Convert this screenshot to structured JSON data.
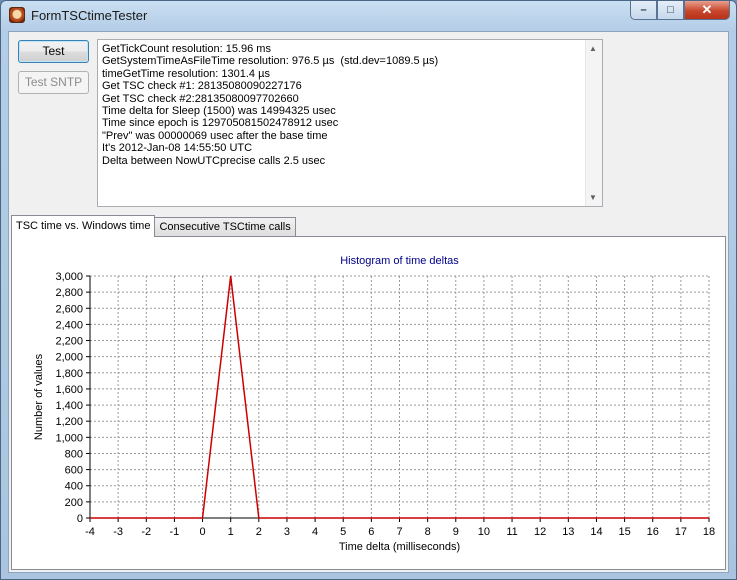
{
  "window": {
    "title": "FormTSCtimeTester",
    "app_icon": "tsc-app-icon",
    "minimize_glyph": "–",
    "maximize_glyph": "□",
    "close_glyph": "✕"
  },
  "buttons": {
    "test_label": "Test",
    "sntp_label": "Test SNTP"
  },
  "log": {
    "lines": [
      "GetTickCount resolution: 15.96 ms",
      "GetSystemTimeAsFileTime resolution: 976.5 µs  (std.dev=1089.5 µs)",
      "timeGetTime resolution: 1301.4 µs",
      "Get TSC check #1: 28135080090227176",
      "Get TSC check #2:28135080097702660",
      "Time delta for Sleep (1500) was 14994325 usec",
      "Time since epoch is 129705081502478912 usec",
      "\"Prev\" was 00000069 usec after the base time",
      "It's 2012-Jan-08 14:55:50 UTC",
      "Delta between NowUTCprecise calls 2.5 usec"
    ]
  },
  "tabs": [
    {
      "label": "TSC time vs. Windows time",
      "active": true
    },
    {
      "label": "Consecutive TSCtime calls",
      "active": false
    }
  ],
  "chart_data": {
    "type": "line",
    "title": "Histogram of time deltas",
    "xlabel": "Time delta (milliseconds)",
    "ylabel": "Number of values",
    "xlim": [
      -4,
      18
    ],
    "ylim": [
      0,
      3000
    ],
    "x_ticks": [
      -4,
      -3,
      -2,
      -1,
      0,
      1,
      2,
      3,
      4,
      5,
      6,
      7,
      8,
      9,
      10,
      11,
      12,
      13,
      14,
      15,
      16,
      17,
      18
    ],
    "y_ticks": [
      0,
      200,
      400,
      600,
      800,
      1000,
      1200,
      1400,
      1600,
      1800,
      2000,
      2200,
      2400,
      2600,
      2800,
      3000
    ],
    "y_tick_labels": [
      "0",
      "200",
      "400",
      "600",
      "800",
      "1,000",
      "1,200",
      "1,400",
      "1,600",
      "1,800",
      "2,000",
      "2,200",
      "2,400",
      "2,600",
      "2,800",
      "3,000"
    ],
    "grid": true,
    "series": [
      {
        "color": "#cc0000",
        "x": [
          -4,
          0,
          1,
          2,
          18
        ],
        "y": [
          0,
          0,
          3000,
          0,
          0
        ]
      }
    ],
    "title_color": "#00008b"
  }
}
